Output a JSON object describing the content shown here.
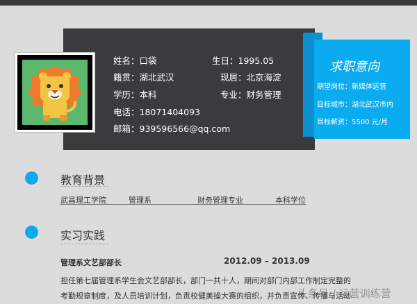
{
  "profile": {
    "name": "姓名：口袋",
    "birthday": "生日：1995.05",
    "hometown": "籍贯：湖北武汉",
    "residence": "现居：北京海淀",
    "education": "学历：本科",
    "major": "专业：财务管理",
    "phone": "电话：18071404093",
    "email": "邮箱：939596566@qq.com"
  },
  "job_intention": {
    "title": "求职意向",
    "position": "期望岗位：新媒体运营",
    "city": "目标城市：湖北武汉市内",
    "salary": "目标薪资：5500 元/月"
  },
  "education_section": {
    "title": "教育背景",
    "school": "武昌理工学院",
    "department": "管理系",
    "major": "财务管理专业",
    "degree": "本科学位"
  },
  "internship_section": {
    "title": "实习实践",
    "role": "管理系文艺部部长",
    "period": "2012.09 – 2013.09",
    "desc_line1": "担任第七届管理系学生会文艺部部长，部门一共十人，期间对部门内部工作制定完整的",
    "desc_line2": "考勤规章制度，及人员培训计划，负责校健美操大赛的组织，并负责宣传、传播与活动"
  },
  "watermark": "头条号 / 运营训练营",
  "colors": {
    "accent": "#12a9ea",
    "card": "#3b3b3e",
    "panel": "#0aabef"
  },
  "avatar": "lion-illustration"
}
